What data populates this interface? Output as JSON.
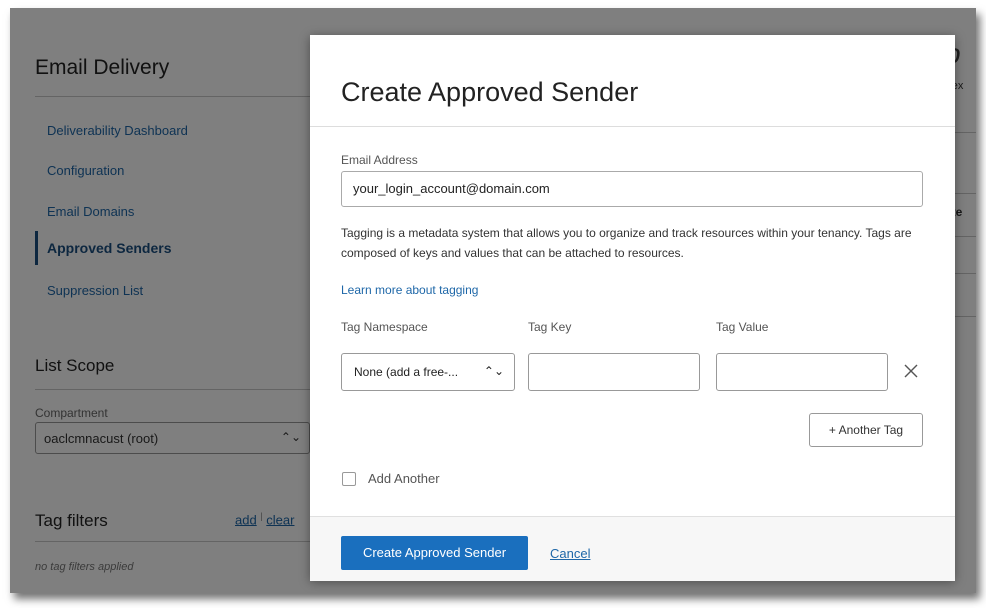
{
  "sidebar": {
    "title": "Email Delivery",
    "items": [
      {
        "label": "Deliverability Dashboard"
      },
      {
        "label": "Configuration"
      },
      {
        "label": "Email Domains"
      },
      {
        "label": "Approved Senders"
      },
      {
        "label": "Suppression List"
      }
    ]
  },
  "list_scope": {
    "title": "List Scope",
    "compartment_label": "Compartment",
    "compartment_value": "oaclcmnacust (root)"
  },
  "tag_filters": {
    "title": "Tag filters",
    "add_label": "add",
    "separator": "|",
    "clear_label": "clear",
    "empty_text": "no tag filters applied"
  },
  "background_right": {
    "heading_fragment": "p",
    "sub_fragment": "r ex",
    "column_fragment": "ate"
  },
  "modal": {
    "title": "Create Approved Sender",
    "email_label": "Email Address",
    "email_value": "your_login_account@domain.com",
    "tagging_description": "Tagging is a metadata system that allows you to organize and track resources within your tenancy. Tags are composed of keys and values that can be attached to resources.",
    "learn_more_label": "Learn more about tagging",
    "tag_namespace_label": "Tag Namespace",
    "tag_key_label": "Tag Key",
    "tag_value_label": "Tag Value",
    "tag_namespace_value": "None (add a free-...",
    "tag_key_value": "",
    "tag_value_value": "",
    "another_tag_label": "+ Another Tag",
    "add_another_label": "Add Another",
    "add_another_checked": false,
    "submit_label": "Create Approved Sender",
    "cancel_label": "Cancel"
  },
  "colors": {
    "primary": "#1a6fbe",
    "link": "#1e67a8",
    "overlay": "rgba(0,0,0,0.5)"
  }
}
